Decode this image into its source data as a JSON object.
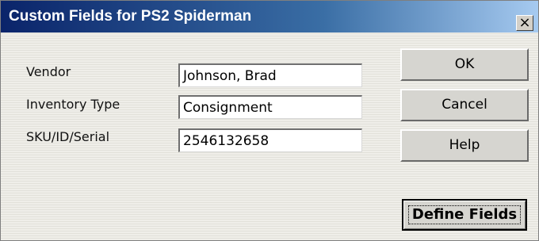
{
  "window": {
    "title": "Custom Fields for PS2 Spiderman",
    "close_label": "×"
  },
  "fields": [
    {
      "label": "Vendor",
      "value": "Johnson, Brad"
    },
    {
      "label": "Inventory Type",
      "value": "Consignment"
    },
    {
      "label": "SKU/ID/Serial",
      "value": "2546132658"
    }
  ],
  "buttons": {
    "ok": "OK",
    "cancel": "Cancel",
    "help": "Help",
    "define_fields": "Define Fields"
  },
  "colors": {
    "titlebar_start": "#0a246a",
    "titlebar_end": "#a6caf0",
    "dialog_background": "#ecebe6"
  }
}
